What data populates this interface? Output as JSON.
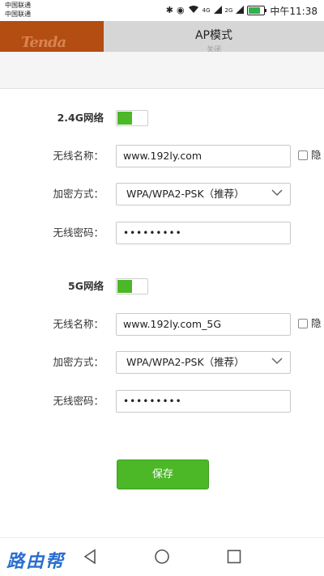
{
  "status_bar": {
    "carrier1": "中国联通",
    "carrier2": "中国联通",
    "signal1_label": "4G",
    "signal2_label": "2G",
    "time": "中午11:38",
    "battery_color": "#2db34a"
  },
  "header": {
    "logo_text": "Tenda",
    "title": "AP模式",
    "subtitle": "关闭",
    "logo_bg": "#b34d12"
  },
  "wifi24": {
    "section_label": "2.4G网络",
    "toggle_on": true,
    "ssid_label": "无线名称：",
    "ssid_value": "www.192ly.com",
    "hide_label": "隐",
    "security_label": "加密方式：",
    "security_value": "WPA/WPA2-PSK（推荐）",
    "password_label": "无线密码：",
    "password_value": "•••••••••"
  },
  "wifi5": {
    "section_label": "5G网络",
    "toggle_on": true,
    "ssid_label": "无线名称：",
    "ssid_value": "www.192ly.com_5G",
    "hide_label": "隐",
    "security_label": "加密方式：",
    "security_value": "WPA/WPA2-PSK（推荐）",
    "password_label": "无线密码：",
    "password_value": "•••••••••"
  },
  "actions": {
    "save_label": "保存",
    "accent": "#4cb827"
  },
  "nav": {
    "watermark": "路由帮",
    "icons": [
      "back-triangle-icon",
      "home-circle-icon",
      "recents-square-icon"
    ]
  }
}
